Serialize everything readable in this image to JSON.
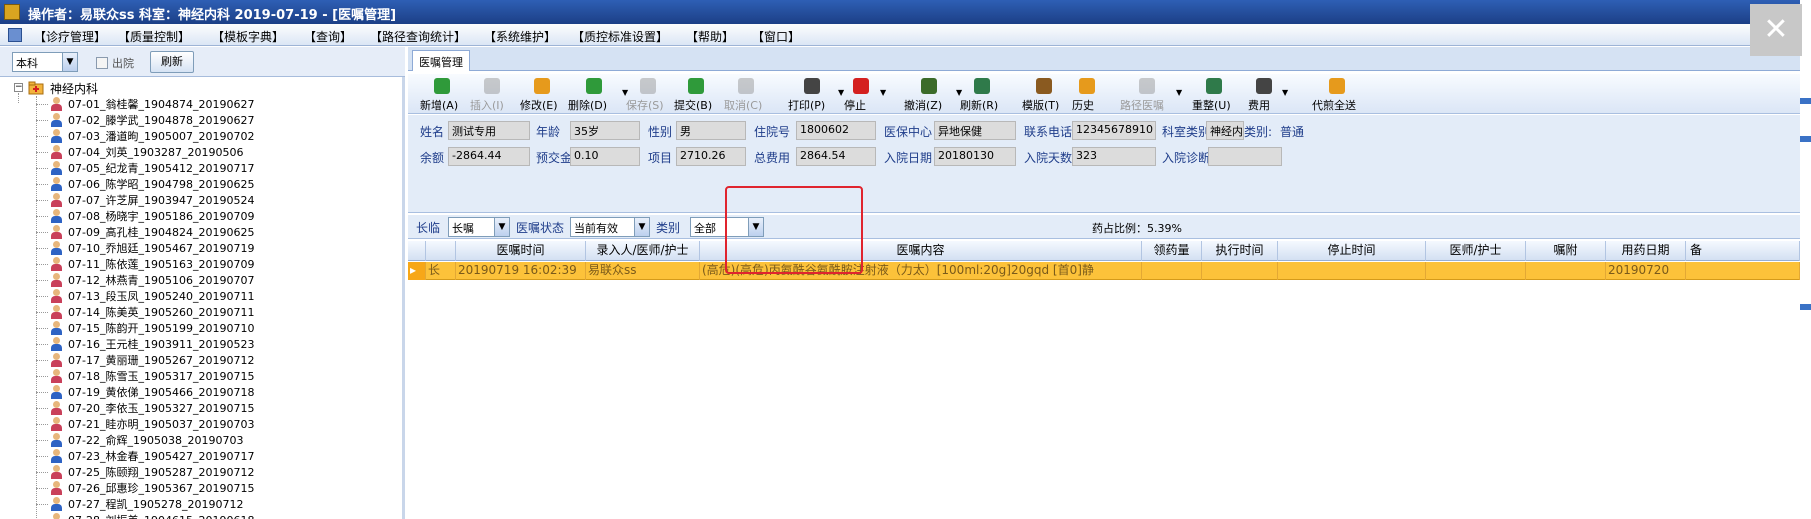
{
  "titlebar": {
    "title": "操作者：易联众ss   科室：神经内科   2019-07-19 - [医嘱管理]",
    "close": "✕"
  },
  "menu": [
    "【诊疗管理】",
    "【质量控制】",
    "【模板字典】",
    "【查询】",
    "【路径查询统计】",
    "【系统维护】",
    "【质控标准设置】",
    "【帮助】",
    "【窗口】"
  ],
  "left": {
    "scope_value": "本科",
    "discharged_label": "出院",
    "refresh_label": "刷新",
    "dept_name": "神经内科",
    "patients": [
      {
        "label": "07-01_翁桂馨_1904874_20190627",
        "g": "f"
      },
      {
        "label": "07-02_滕学武_1904878_20190627",
        "g": "m"
      },
      {
        "label": "07-03_潘道昫_1905007_20190702",
        "g": "m"
      },
      {
        "label": "07-04_刘英_1903287_20190506",
        "g": "f"
      },
      {
        "label": "07-05_纪龙青_1905412_20190717",
        "g": "m"
      },
      {
        "label": "07-06_陈学昭_1904798_20190625",
        "g": "m"
      },
      {
        "label": "07-07_许芝屏_1903947_20190524",
        "g": "f"
      },
      {
        "label": "07-08_杨晓宇_1905186_20190709",
        "g": "m"
      },
      {
        "label": "07-09_高孔桂_1904824_20190625",
        "g": "f"
      },
      {
        "label": "07-10_乔旭廷_1905467_20190719",
        "g": "m"
      },
      {
        "label": "07-11_陈依莲_1905163_20190709",
        "g": "f"
      },
      {
        "label": "07-12_林燕青_1905106_20190707",
        "g": "f"
      },
      {
        "label": "07-13_段玉凤_1905240_20190711",
        "g": "f"
      },
      {
        "label": "07-14_陈美英_1905260_20190711",
        "g": "f"
      },
      {
        "label": "07-15_陈韵开_1905199_20190710",
        "g": "m"
      },
      {
        "label": "07-16_王元桂_1903911_20190523",
        "g": "m"
      },
      {
        "label": "07-17_黄丽珊_1905267_20190712",
        "g": "f"
      },
      {
        "label": "07-18_陈雪玉_1905317_20190715",
        "g": "f"
      },
      {
        "label": "07-19_黄依俤_1905466_20190718",
        "g": "m"
      },
      {
        "label": "07-20_李依玉_1905327_20190715",
        "g": "f"
      },
      {
        "label": "07-21_眭亦明_1905037_20190703",
        "g": "f"
      },
      {
        "label": "07-22_俞辉_1905038_20190703",
        "g": "m"
      },
      {
        "label": "07-23_林金春_1905427_20190717",
        "g": "m"
      },
      {
        "label": "07-25_陈颐翔_1905287_20190712",
        "g": "f"
      },
      {
        "label": "07-26_邱惠珍_1905367_20190715",
        "g": "f"
      },
      {
        "label": "07-27_程凯_1905278_20190712",
        "g": "m"
      },
      {
        "label": "07-28_刘振美_1904615_20190618",
        "g": "m"
      }
    ]
  },
  "right": {
    "tab_label": "医嘱管理",
    "toolbar": [
      {
        "label": "新增(A)",
        "name": "add",
        "color": "#2f9a3a",
        "dis": false
      },
      {
        "label": "插入(I)",
        "name": "insert",
        "color": "#8e8e8e",
        "dis": true
      },
      {
        "label": "修改(E)",
        "name": "edit",
        "color": "#e69a1c",
        "dis": false
      },
      {
        "label": "删除(D)",
        "name": "delete",
        "color": "#2f9a3a",
        "dis": false,
        "arrow": true
      },
      {
        "label": "保存(S)",
        "name": "save",
        "color": "#8e8e8e",
        "dis": true
      },
      {
        "label": "提交(B)",
        "name": "submit",
        "color": "#2f9a3a",
        "dis": false
      },
      {
        "label": "取消(C)",
        "name": "cancel",
        "color": "#8e8e8e",
        "dis": true
      },
      {
        "label": "打印(P)",
        "name": "print",
        "color": "#444444",
        "dis": false,
        "arrow": true
      },
      {
        "label": "停止",
        "name": "stop",
        "color": "#d42020",
        "dis": false,
        "arrow": true
      },
      {
        "label": "撤消(Z)",
        "name": "undo",
        "color": "#3b6b2a",
        "dis": false,
        "arrow": true
      },
      {
        "label": "刷新(R)",
        "name": "refresh",
        "color": "#2f7a4a",
        "dis": false
      },
      {
        "label": "模版(T)",
        "name": "template",
        "color": "#8a5a20",
        "dis": false
      },
      {
        "label": "历史",
        "name": "history",
        "color": "#e69a1c",
        "dis": false
      },
      {
        "label": "路径医嘱",
        "name": "pathway",
        "color": "#8e8e8e",
        "dis": true,
        "arrow": true
      },
      {
        "label": "重整(U)",
        "name": "reorganize",
        "color": "#2f7a4a",
        "dis": false
      },
      {
        "label": "费用",
        "name": "fee",
        "color": "#444444",
        "dis": false,
        "arrow": true
      },
      {
        "label": "代煎全送",
        "name": "decoct",
        "color": "#e69a1c",
        "dis": false
      }
    ],
    "info": {
      "name_label": "姓名",
      "name": "测试专用",
      "age_label": "年龄",
      "age": "35岁",
      "sex_label": "性别",
      "sex": "男",
      "admission_no_label": "住院号",
      "admission_no": "1800602",
      "insurance_label": "医保中心",
      "insurance": "异地保健",
      "phone_label": "联系电话",
      "phone": "12345678910",
      "dept_type_label": "科室类别",
      "dept_type": "神经内",
      "category_label": "类别:",
      "category": "普通",
      "balance_label": "余额",
      "balance": "-2864.44",
      "deposit_label": "预交金",
      "deposit": "0.10",
      "item_label": "项目",
      "item": "2710.26",
      "total_label": "总费用",
      "total": "2864.54",
      "admit_date_label": "入院日期",
      "admit_date": "20180130",
      "admit_days_label": "入院天数",
      "admit_days": "323",
      "diagnosis_label": "入院诊断",
      "diagnosis": ""
    },
    "filter": {
      "term_label": "长临",
      "term_value": "长嘱",
      "status_label": "医嘱状态",
      "status_value": "当前有效",
      "type_label": "类别",
      "type_value": "全部",
      "drug_ratio": "药占比例：5.39%"
    },
    "grid": {
      "columns": [
        "医嘱时间",
        "录入人/医师/护士",
        "医嘱内容",
        "领药量",
        "执行时间",
        "停止时间",
        "医师/护士",
        "嘱附",
        "用药日期",
        "备"
      ],
      "rows": [
        {
          "marker": "▸",
          "kind": "长",
          "time": "20190719 16:02:39",
          "entered_by": "易联众ss",
          "content": "(高危)(高危)丙氨酰谷氨酰胺注射液（力太）[100ml:20g]20gqd [首0]静",
          "qty": "",
          "exec_time": "",
          "stop_time": "",
          "doctor": "",
          "note": "",
          "med_date": "20190720",
          "extra": ""
        }
      ]
    }
  }
}
